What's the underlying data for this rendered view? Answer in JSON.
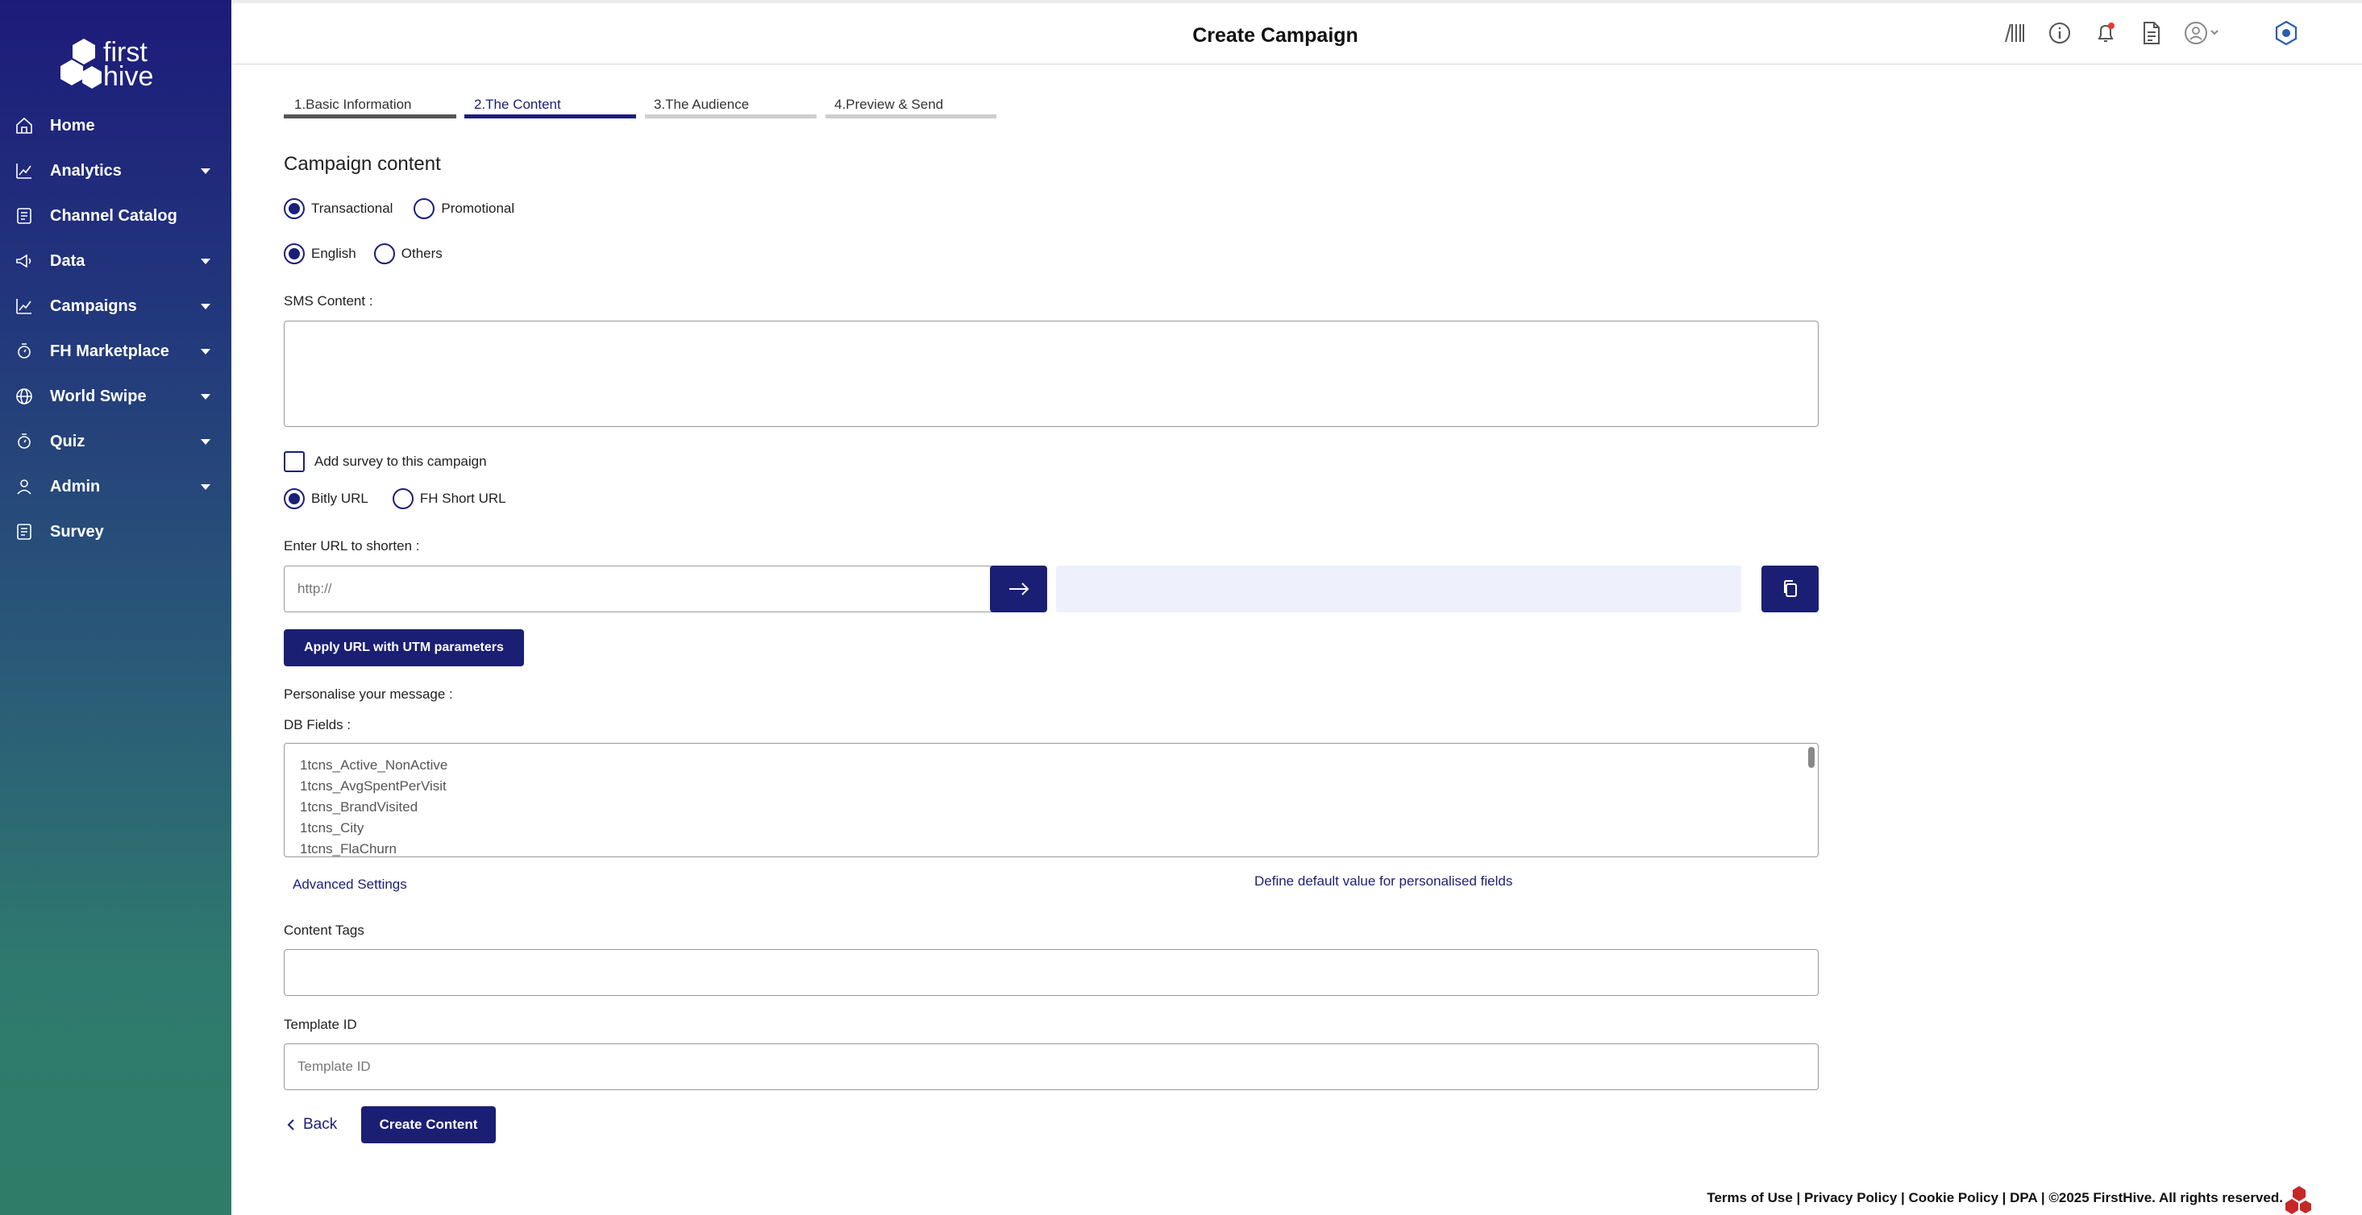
{
  "brand": {
    "logo_line1": "first",
    "logo_line2": "hive"
  },
  "sidebar": {
    "items": [
      {
        "label": "Home",
        "icon": "home-icon",
        "has_caret": false
      },
      {
        "label": "Analytics",
        "icon": "analytics-icon",
        "has_caret": true
      },
      {
        "label": "Channel Catalog",
        "icon": "catalog-icon",
        "has_caret": false
      },
      {
        "label": "Data",
        "icon": "megaphone-icon",
        "has_caret": true
      },
      {
        "label": "Campaigns",
        "icon": "chart-icon",
        "has_caret": true
      },
      {
        "label": "FH Marketplace",
        "icon": "marketplace-icon",
        "has_caret": true
      },
      {
        "label": "World Swipe",
        "icon": "globe-icon",
        "has_caret": true
      },
      {
        "label": "Quiz",
        "icon": "quiz-icon",
        "has_caret": true
      },
      {
        "label": "Admin",
        "icon": "user-icon",
        "has_caret": true
      },
      {
        "label": "Survey",
        "icon": "survey-icon",
        "has_caret": false
      }
    ]
  },
  "header": {
    "title": "Create Campaign"
  },
  "stepper": {
    "steps": [
      {
        "label": "1.Basic Information",
        "state": "done"
      },
      {
        "label": "2.The Content",
        "state": "active"
      },
      {
        "label": "3.The Audience",
        "state": "todo"
      },
      {
        "label": "4.Preview & Send",
        "state": "todo"
      }
    ]
  },
  "content": {
    "section_title": "Campaign content",
    "type_options": [
      "Transactional",
      "Promotional"
    ],
    "type_selected": "Transactional",
    "language_options": [
      "English",
      "Others"
    ],
    "language_selected": "English",
    "sms_label": "SMS Content :",
    "survey_label": "Add survey to this campaign",
    "url_type_options": [
      "Bitly URL",
      "FH Short URL"
    ],
    "url_type_selected": "Bitly URL",
    "url_label": "Enter URL to shorten :",
    "url_placeholder": "http://",
    "utm_button": "Apply URL with UTM parameters",
    "personalise_label": "Personalise your message :",
    "db_fields_label": "DB Fields :",
    "db_fields": [
      "1tcns_Active_NonActive",
      "1tcns_AvgSpentPerVisit",
      "1tcns_BrandVisited",
      "1tcns_City",
      "1tcns_FlaChurn"
    ],
    "advanced_settings": "Advanced Settings",
    "define_default": "Define default value for personalised fields",
    "content_tags_label": "Content Tags",
    "template_id_label": "Template ID",
    "template_id_placeholder": "Template ID",
    "back_button": "Back",
    "create_button": "Create Content"
  },
  "footer": {
    "text": "Terms of Use | Privacy Policy | Cookie Policy | DPA | ©2025 FirstHive. All rights reserved."
  },
  "colors": {
    "primary": "#1b1f73",
    "sidebar_top": "#1d1b7a",
    "sidebar_bottom": "#2f7d68",
    "notification": "#e53935"
  }
}
